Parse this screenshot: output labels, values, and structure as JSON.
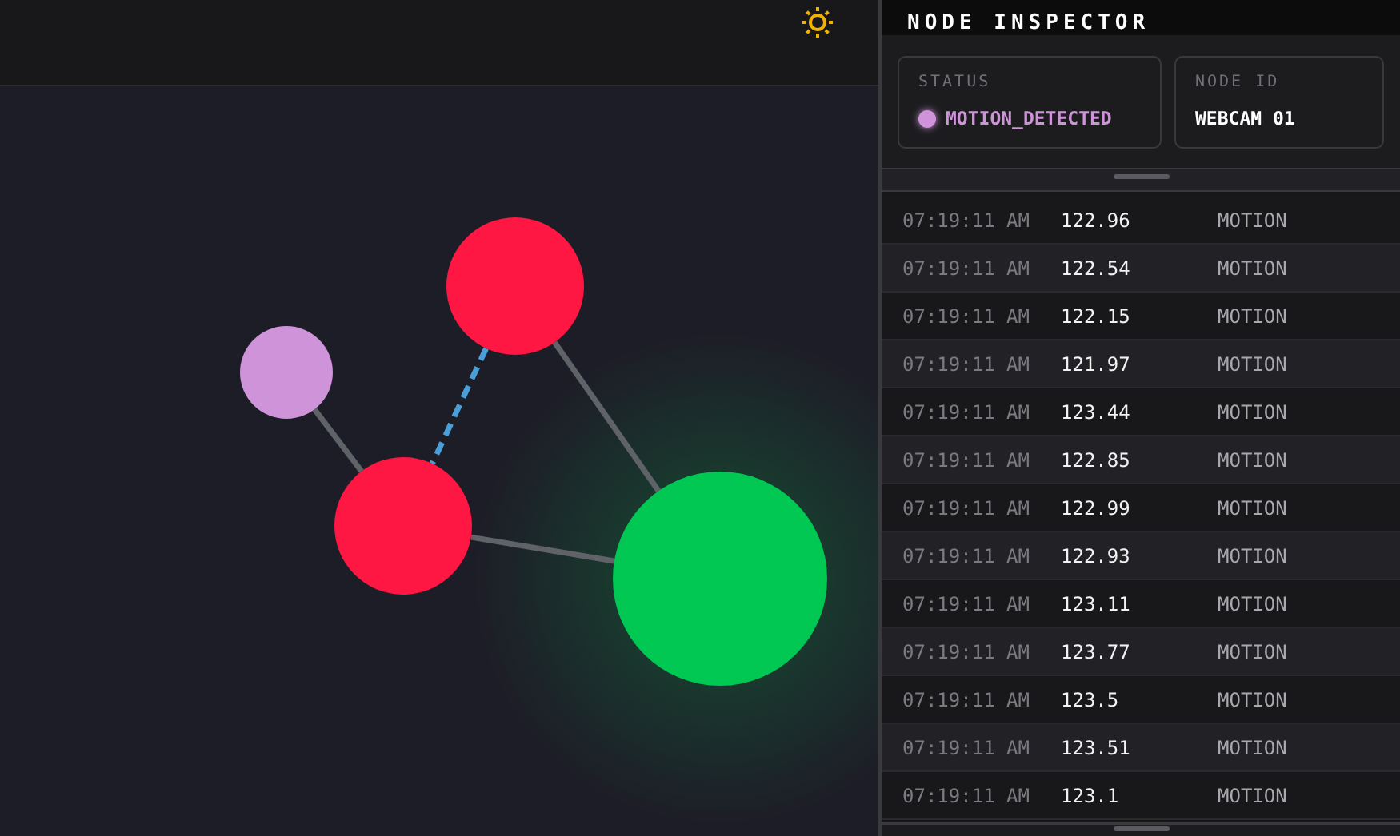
{
  "graph": {
    "nodes": [
      {
        "color": "#ce93d8",
        "glow": false
      },
      {
        "color": "#ff1744",
        "glow": false
      },
      {
        "color": "#ff1744",
        "glow": false
      },
      {
        "color": "#00c853",
        "glow": true
      }
    ],
    "edges": [
      {
        "kind": "solid"
      },
      {
        "kind": "dashed"
      },
      {
        "kind": "solid"
      },
      {
        "kind": "solid"
      }
    ]
  },
  "inspector": {
    "title": "NODE INSPECTOR",
    "status": {
      "label": "STATUS",
      "value": "MOTION_DETECTED",
      "color": "#ce93d8"
    },
    "node_id": {
      "label": "NODE ID",
      "value": "WEBCAM 01"
    },
    "log": [
      {
        "time": "07:19:11 AM",
        "value": "122.96",
        "type": "MOTION"
      },
      {
        "time": "07:19:11 AM",
        "value": "122.54",
        "type": "MOTION"
      },
      {
        "time": "07:19:11 AM",
        "value": "122.15",
        "type": "MOTION"
      },
      {
        "time": "07:19:11 AM",
        "value": "121.97",
        "type": "MOTION"
      },
      {
        "time": "07:19:11 AM",
        "value": "123.44",
        "type": "MOTION"
      },
      {
        "time": "07:19:11 AM",
        "value": "122.85",
        "type": "MOTION"
      },
      {
        "time": "07:19:11 AM",
        "value": "122.99",
        "type": "MOTION"
      },
      {
        "time": "07:19:11 AM",
        "value": "122.93",
        "type": "MOTION"
      },
      {
        "time": "07:19:11 AM",
        "value": "123.11",
        "type": "MOTION"
      },
      {
        "time": "07:19:11 AM",
        "value": "123.77",
        "type": "MOTION"
      },
      {
        "time": "07:19:11 AM",
        "value": "123.5",
        "type": "MOTION"
      },
      {
        "time": "07:19:11 AM",
        "value": "123.51",
        "type": "MOTION"
      },
      {
        "time": "07:19:11 AM",
        "value": "123.1",
        "type": "MOTION"
      }
    ]
  }
}
